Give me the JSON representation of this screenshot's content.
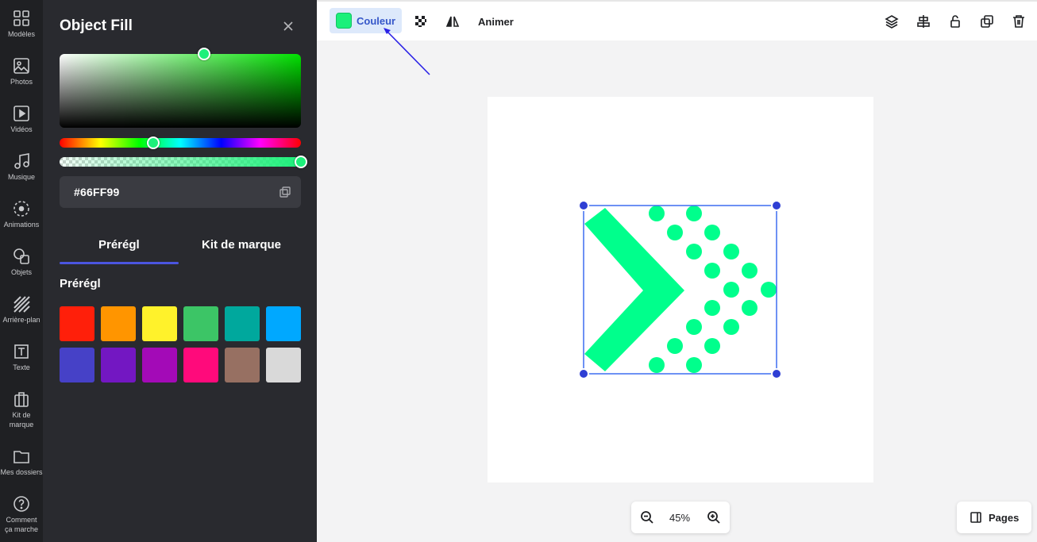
{
  "sidebar": {
    "items": [
      {
        "label": "Modèles",
        "icon": "grid-icon"
      },
      {
        "label": "Photos",
        "icon": "image-icon"
      },
      {
        "label": "Vidéos",
        "icon": "video-icon"
      },
      {
        "label": "Musique",
        "icon": "music-icon"
      },
      {
        "label": "Animations",
        "icon": "animation-icon"
      },
      {
        "label": "Objets",
        "icon": "shapes-icon"
      },
      {
        "label": "Arrière-plan",
        "icon": "background-icon"
      },
      {
        "label": "Texte",
        "icon": "text-icon"
      },
      {
        "label": "Kit de marque",
        "icon": "briefcase-icon"
      },
      {
        "label": "Mes dossiers",
        "icon": "folder-icon"
      },
      {
        "label": "Comment ça marche",
        "icon": "help-icon"
      }
    ]
  },
  "panel": {
    "title": "Object Fill",
    "hex_value": "#66FF99",
    "tabs": [
      {
        "label": "Prérégl",
        "active": true
      },
      {
        "label": "Kit de marque",
        "active": false
      }
    ],
    "section_title": "Prérégl",
    "swatches": [
      "#ff1f0a",
      "#ff9500",
      "#fff22b",
      "#3cc566",
      "#00a89d",
      "#00a8ff",
      "#4641c7",
      "#7317c2",
      "#a30ab7",
      "#ff0a7b",
      "#977062",
      "#d9d9d9"
    ]
  },
  "toolbar": {
    "color_label": "Couleur",
    "animate_label": "Animer",
    "fill_color": "#1cf07a"
  },
  "zoom": {
    "value": "45%"
  },
  "pages": {
    "label": "Pages"
  }
}
